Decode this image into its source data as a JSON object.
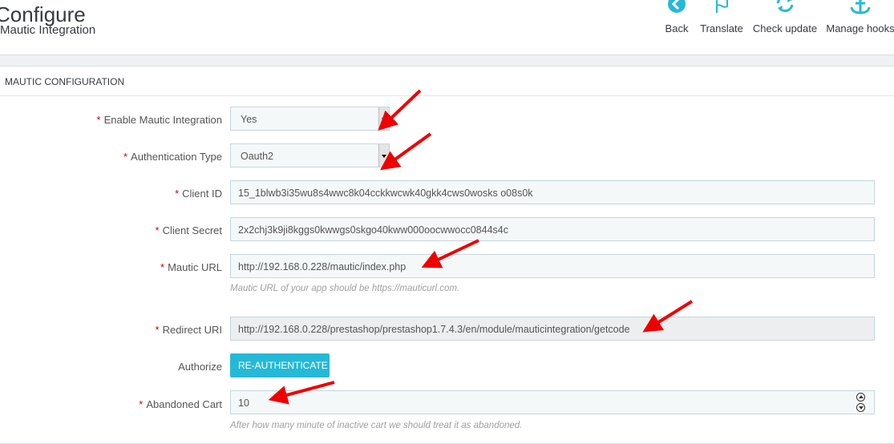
{
  "header": {
    "title": "Configure",
    "subtitle": "Mautic Integration",
    "toolbar": [
      {
        "label": "Back",
        "icon": "back-icon"
      },
      {
        "label": "Translate",
        "icon": "flag-icon"
      },
      {
        "label": "Check update",
        "icon": "refresh-icon"
      },
      {
        "label": "Manage hooks",
        "icon": "anchor-icon"
      }
    ]
  },
  "panel": {
    "title": "MAUTIC CONFIGURATION",
    "fields": {
      "enable": {
        "label": "Enable Mautic Integration",
        "value": "Yes"
      },
      "auth_type": {
        "label": "Authentication Type",
        "value": "Oauth2"
      },
      "client_id": {
        "label": "Client ID",
        "value": "15_1blwb3i35wu8s4wwc8k04cckkwcwk40gkk4cws0wosks o08s0k"
      },
      "client_secret": {
        "label": "Client Secret",
        "value": "2x2chj3k9ji8kggs0kwwgs0skgo40kww000oocwwocc0844s4c"
      },
      "mautic_url": {
        "label": "Mautic URL",
        "value": "http://192.168.0.228/mautic/index.php",
        "help": "Mautic URL of your app should be https://mauticurl.com."
      },
      "redirect_uri": {
        "label": "Redirect URI",
        "value": "http://192.168.0.228/prestashop/prestashop1.7.4.3/en/module/mauticintegration/getcode"
      },
      "authorize": {
        "label": "Authorize",
        "button": "RE-AUTHENTICATE"
      },
      "abandoned": {
        "label": "Abandoned Cart",
        "value": "10",
        "help": "After how many minute of inactive cart we should treat it as abandoned."
      }
    }
  },
  "required_mark": "*",
  "colors": {
    "accent": "#25b9d7",
    "required": "#c3001b",
    "annotation_arrow": "#ee0000"
  }
}
